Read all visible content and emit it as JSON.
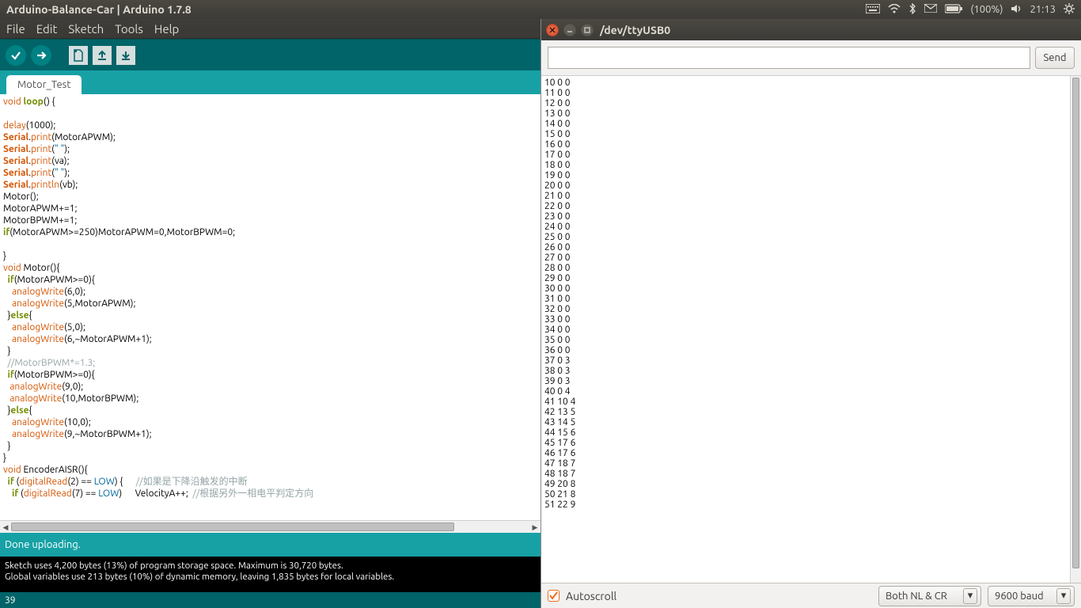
{
  "system": {
    "window_title": "Arduino-Balance-Car | Arduino 1.7.8",
    "battery_pct": "(100%)",
    "clock": "21:13"
  },
  "menubar": [
    "File",
    "Edit",
    "Sketch",
    "Tools",
    "Help"
  ],
  "tabs": {
    "active": "Motor_Test"
  },
  "status": {
    "message": "Done uploading.",
    "console_line1": "Sketch uses 4,200 bytes (13%) of program storage space. Maximum is 30,720 bytes.",
    "console_line2": "Global variables use 213 bytes (10%) of dynamic memory, leaving 1,835 bytes for local variables.",
    "cursor_line": "39"
  },
  "serial": {
    "title": "/dev/ttyUSB0",
    "send_label": "Send",
    "input_value": "",
    "autoscroll_label": "Autoscroll",
    "autoscroll_checked": true,
    "line_ending": "Both NL & CR",
    "baud": "9600 baud",
    "lines": [
      "10 0 0",
      "11 0 0",
      "12 0 0",
      "13 0 0",
      "14 0 0",
      "15 0 0",
      "16 0 0",
      "17 0 0",
      "18 0 0",
      "19 0 0",
      "20 0 0",
      "21 0 0",
      "22 0 0",
      "23 0 0",
      "24 0 0",
      "25 0 0",
      "26 0 0",
      "27 0 0",
      "28 0 0",
      "29 0 0",
      "30 0 0",
      "31 0 0",
      "32 0 0",
      "33 0 0",
      "34 0 0",
      "35 0 0",
      "36 0 0",
      "37 0 3",
      "38 0 3",
      "39 0 3",
      "40 0 4",
      "41 10 4",
      "42 13 5",
      "43 14 5",
      "44 15 6",
      "45 17 6",
      "46 17 6",
      "47 18 7",
      "48 18 7",
      "49 20 8",
      "50 21 8",
      "51 22 9"
    ]
  },
  "code": {
    "line_a": [
      "void ",
      "loop",
      "() {"
    ],
    "blank1": "",
    "delay": [
      "delay",
      "(1000);"
    ],
    "spA": [
      "Serial",
      ".",
      "print",
      "(MotorAPWM);"
    ],
    "sp1": [
      "Serial",
      ".",
      "print",
      "(",
      "\" \"",
      ");"
    ],
    "spva": [
      "Serial",
      ".",
      "print",
      "(va);"
    ],
    "sp2": [
      "Serial",
      ".",
      "print",
      "(",
      "\" \"",
      ");"
    ],
    "spvb": [
      "Serial",
      ".",
      "println",
      "(vb);"
    ],
    "motorcall": "Motor();",
    "inc1": "MotorAPWM+=1;",
    "inc2": "MotorBPWM+=1;",
    "ifcap": [
      "if",
      "(MotorAPWM>=250)MotorAPWM=0,MotorBPWM=0;"
    ],
    "blank2": "",
    "brace_close": "}",
    "motor_def": [
      "void",
      " Motor(){"
    ],
    "m_if1": [
      "  ",
      "if",
      "(MotorAPWM>=0){"
    ],
    "m_aw60": [
      "    ",
      "analogWrite",
      "(6,0);"
    ],
    "m_aw5a": [
      "    ",
      "analogWrite",
      "(5,MotorAPWM);"
    ],
    "m_else1": [
      "  }",
      "else",
      "{"
    ],
    "m_aw50": [
      "    ",
      "analogWrite",
      "(5,0);"
    ],
    "m_aw6n": [
      "    ",
      "analogWrite",
      "(6,~MotorAPWM+1);"
    ],
    "m_end1": "  }",
    "m_cmt": "  //MotorBPWM*=1.3;",
    "m_if2": [
      "  ",
      "if",
      "(MotorBPWM>=0){"
    ],
    "m_aw90": [
      "   ",
      "analogWrite",
      "(9,0);"
    ],
    "m_aw10b": [
      "   ",
      "analogWrite",
      "(10,MotorBPWM);"
    ],
    "m_else2": [
      "  }",
      "else",
      "{"
    ],
    "m_aw100": [
      "    ",
      "analogWrite",
      "(10,0);"
    ],
    "m_aw9n": [
      "    ",
      "analogWrite",
      "(9,~MotorBPWM+1);"
    ],
    "m_end2": "  }",
    "brace_close2": "}",
    "enc_def": [
      "void",
      " EncoderAISR(){"
    ],
    "enc_if1a": [
      "  ",
      "if",
      " (",
      "digitalRead",
      "(2) == ",
      "LOW",
      ") {      "
    ],
    "enc_if1_cmt": "//如果是下降沿触发的中断",
    "enc_if2a": [
      "    ",
      "if",
      " (",
      "digitalRead",
      "(7) == ",
      "LOW",
      ")      VelocityA++;  "
    ],
    "enc_if2_cmt": "//根据另外一相电平判定方向"
  }
}
